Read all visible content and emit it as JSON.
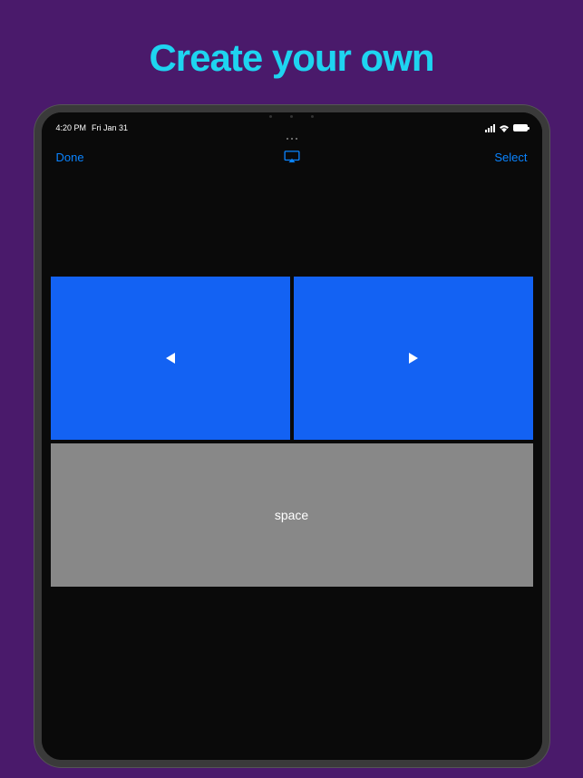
{
  "headline": "Create your own",
  "statusBar": {
    "time": "4:20 PM",
    "date": "Fri Jan 31"
  },
  "navBar": {
    "leftButton": "Done",
    "rightButton": "Select"
  },
  "keys": {
    "space": "space"
  }
}
